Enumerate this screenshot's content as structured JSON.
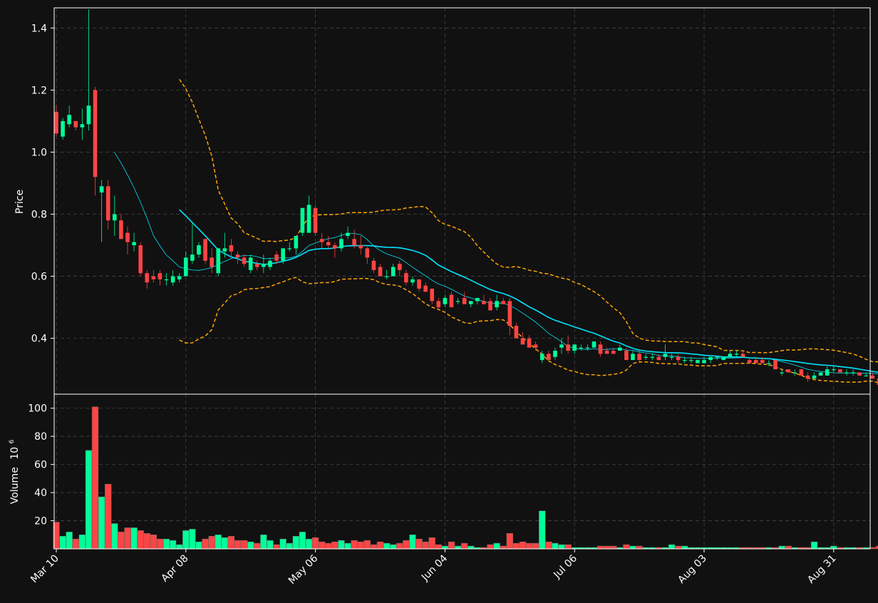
{
  "chart_data": [
    {
      "type": "candlestick",
      "ylabel": "Price",
      "ylim": [
        0.22,
        1.465
      ],
      "yticks": [
        0.4,
        0.6,
        0.8,
        1.0,
        1.2,
        1.4
      ],
      "grid": true,
      "x": {
        "start_date": "Mar 10",
        "tick_labels": [
          "Mar 10",
          "Apr 08",
          "May 06",
          "Jun 04",
          "Jul 06",
          "Aug 03",
          "Aug 31"
        ],
        "tick_index": [
          0,
          20,
          40,
          60,
          80,
          100,
          120
        ]
      },
      "ohlc": [
        [
          1.13,
          1.15,
          1.05,
          1.06
        ],
        [
          1.05,
          1.11,
          1.04,
          1.1
        ],
        [
          1.09,
          1.15,
          1.08,
          1.12
        ],
        [
          1.1,
          1.1,
          1.07,
          1.08
        ],
        [
          1.08,
          1.14,
          1.04,
          1.09
        ],
        [
          1.09,
          1.46,
          1.07,
          1.15
        ],
        [
          1.2,
          1.21,
          0.86,
          0.92
        ],
        [
          0.87,
          0.91,
          0.71,
          0.89
        ],
        [
          0.89,
          0.91,
          0.75,
          0.78
        ],
        [
          0.78,
          0.86,
          0.73,
          0.8
        ],
        [
          0.78,
          0.8,
          0.72,
          0.72
        ],
        [
          0.74,
          0.76,
          0.67,
          0.71
        ],
        [
          0.7,
          0.74,
          0.68,
          0.71
        ],
        [
          0.7,
          0.71,
          0.6,
          0.61
        ],
        [
          0.61,
          0.62,
          0.56,
          0.58
        ],
        [
          0.6,
          0.62,
          0.58,
          0.59
        ],
        [
          0.61,
          0.62,
          0.57,
          0.59
        ],
        [
          0.59,
          0.61,
          0.57,
          0.59
        ],
        [
          0.58,
          0.62,
          0.57,
          0.6
        ],
        [
          0.59,
          0.61,
          0.58,
          0.6
        ],
        [
          0.6,
          0.68,
          0.6,
          0.66
        ],
        [
          0.65,
          0.77,
          0.64,
          0.67
        ],
        [
          0.67,
          0.71,
          0.66,
          0.7
        ],
        [
          0.72,
          0.72,
          0.64,
          0.65
        ],
        [
          0.66,
          0.69,
          0.61,
          0.63
        ],
        [
          0.61,
          0.69,
          0.6,
          0.69
        ],
        [
          0.68,
          0.74,
          0.66,
          0.69
        ],
        [
          0.7,
          0.72,
          0.66,
          0.68
        ],
        [
          0.67,
          0.68,
          0.64,
          0.66
        ],
        [
          0.66,
          0.67,
          0.63,
          0.64
        ],
        [
          0.62,
          0.67,
          0.61,
          0.66
        ],
        [
          0.64,
          0.65,
          0.62,
          0.63
        ],
        [
          0.63,
          0.67,
          0.61,
          0.64
        ],
        [
          0.63,
          0.66,
          0.62,
          0.65
        ],
        [
          0.67,
          0.68,
          0.64,
          0.65
        ],
        [
          0.65,
          0.69,
          0.64,
          0.69
        ],
        [
          0.69,
          0.71,
          0.68,
          0.69
        ],
        [
          0.69,
          0.73,
          0.67,
          0.73
        ],
        [
          0.74,
          0.82,
          0.73,
          0.82
        ],
        [
          0.74,
          0.86,
          0.74,
          0.83
        ],
        [
          0.82,
          0.83,
          0.73,
          0.74
        ],
        [
          0.72,
          0.74,
          0.69,
          0.71
        ],
        [
          0.71,
          0.73,
          0.69,
          0.7
        ],
        [
          0.7,
          0.71,
          0.66,
          0.69
        ],
        [
          0.69,
          0.74,
          0.68,
          0.72
        ],
        [
          0.73,
          0.76,
          0.72,
          0.74
        ],
        [
          0.72,
          0.75,
          0.69,
          0.7
        ],
        [
          0.7,
          0.73,
          0.67,
          0.69
        ],
        [
          0.69,
          0.7,
          0.64,
          0.66
        ],
        [
          0.65,
          0.66,
          0.61,
          0.62
        ],
        [
          0.63,
          0.64,
          0.6,
          0.6
        ],
        [
          0.6,
          0.62,
          0.59,
          0.6
        ],
        [
          0.6,
          0.64,
          0.6,
          0.63
        ],
        [
          0.64,
          0.65,
          0.6,
          0.62
        ],
        [
          0.61,
          0.62,
          0.57,
          0.58
        ],
        [
          0.58,
          0.6,
          0.57,
          0.59
        ],
        [
          0.59,
          0.59,
          0.55,
          0.56
        ],
        [
          0.57,
          0.58,
          0.55,
          0.55
        ],
        [
          0.56,
          0.56,
          0.51,
          0.52
        ],
        [
          0.52,
          0.53,
          0.49,
          0.5
        ],
        [
          0.51,
          0.54,
          0.5,
          0.53
        ],
        [
          0.54,
          0.55,
          0.5,
          0.5
        ],
        [
          0.52,
          0.53,
          0.51,
          0.52
        ],
        [
          0.53,
          0.55,
          0.51,
          0.51
        ],
        [
          0.51,
          0.52,
          0.5,
          0.52
        ],
        [
          0.52,
          0.53,
          0.51,
          0.53
        ],
        [
          0.52,
          0.54,
          0.51,
          0.51
        ],
        [
          0.52,
          0.53,
          0.49,
          0.49
        ],
        [
          0.5,
          0.54,
          0.49,
          0.52
        ],
        [
          0.52,
          0.53,
          0.51,
          0.51
        ],
        [
          0.52,
          0.53,
          0.41,
          0.44
        ],
        [
          0.44,
          0.45,
          0.4,
          0.4
        ],
        [
          0.4,
          0.42,
          0.38,
          0.38
        ],
        [
          0.4,
          0.41,
          0.37,
          0.37
        ],
        [
          0.38,
          0.39,
          0.36,
          0.37
        ],
        [
          0.33,
          0.36,
          0.32,
          0.35
        ],
        [
          0.35,
          0.36,
          0.33,
          0.33
        ],
        [
          0.34,
          0.37,
          0.33,
          0.36
        ],
        [
          0.37,
          0.4,
          0.35,
          0.38
        ],
        [
          0.38,
          0.41,
          0.35,
          0.36
        ],
        [
          0.36,
          0.38,
          0.35,
          0.38
        ],
        [
          0.37,
          0.38,
          0.36,
          0.37
        ],
        [
          0.37,
          0.38,
          0.36,
          0.37
        ],
        [
          0.37,
          0.39,
          0.37,
          0.39
        ],
        [
          0.38,
          0.39,
          0.34,
          0.35
        ],
        [
          0.36,
          0.37,
          0.35,
          0.35
        ],
        [
          0.36,
          0.37,
          0.35,
          0.35
        ],
        [
          0.36,
          0.38,
          0.36,
          0.37
        ],
        [
          0.36,
          0.37,
          0.33,
          0.33
        ],
        [
          0.33,
          0.36,
          0.33,
          0.35
        ],
        [
          0.35,
          0.36,
          0.32,
          0.33
        ],
        [
          0.34,
          0.35,
          0.33,
          0.34
        ],
        [
          0.34,
          0.35,
          0.33,
          0.34
        ],
        [
          0.34,
          0.35,
          0.33,
          0.33
        ],
        [
          0.34,
          0.38,
          0.33,
          0.35
        ],
        [
          0.34,
          0.35,
          0.33,
          0.34
        ],
        [
          0.34,
          0.35,
          0.32,
          0.33
        ],
        [
          0.33,
          0.34,
          0.32,
          0.33
        ],
        [
          0.33,
          0.34,
          0.32,
          0.33
        ],
        [
          0.32,
          0.33,
          0.32,
          0.33
        ],
        [
          0.32,
          0.34,
          0.32,
          0.33
        ],
        [
          0.33,
          0.34,
          0.32,
          0.34
        ],
        [
          0.34,
          0.34,
          0.33,
          0.34
        ],
        [
          0.33,
          0.34,
          0.33,
          0.34
        ],
        [
          0.34,
          0.36,
          0.34,
          0.35
        ],
        [
          0.35,
          0.36,
          0.34,
          0.35
        ],
        [
          0.35,
          0.36,
          0.34,
          0.34
        ],
        [
          0.33,
          0.34,
          0.32,
          0.32
        ],
        [
          0.33,
          0.34,
          0.32,
          0.32
        ],
        [
          0.33,
          0.34,
          0.32,
          0.32
        ],
        [
          0.32,
          0.33,
          0.31,
          0.32
        ],
        [
          0.33,
          0.33,
          0.3,
          0.3
        ],
        [
          0.29,
          0.3,
          0.28,
          0.29
        ],
        [
          0.3,
          0.3,
          0.29,
          0.29
        ],
        [
          0.29,
          0.3,
          0.28,
          0.29
        ],
        [
          0.3,
          0.3,
          0.28,
          0.28
        ],
        [
          0.28,
          0.29,
          0.26,
          0.27
        ],
        [
          0.27,
          0.29,
          0.27,
          0.28
        ],
        [
          0.28,
          0.29,
          0.28,
          0.29
        ],
        [
          0.28,
          0.31,
          0.28,
          0.3
        ],
        [
          0.3,
          0.31,
          0.29,
          0.3
        ],
        [
          0.3,
          0.3,
          0.29,
          0.29
        ],
        [
          0.29,
          0.3,
          0.28,
          0.29
        ],
        [
          0.29,
          0.3,
          0.28,
          0.29
        ],
        [
          0.29,
          0.29,
          0.28,
          0.28
        ],
        [
          0.28,
          0.29,
          0.28,
          0.28
        ],
        [
          0.28,
          0.29,
          0.27,
          0.27
        ],
        [
          0.27,
          0.28,
          0.24,
          0.25
        ],
        [
          0.25,
          0.28,
          0.24,
          0.27
        ]
      ],
      "overlays": [
        {
          "kind": "moving-average-fast",
          "window": 10,
          "start_index": 9,
          "color": "#00e5ff",
          "width": 0.8,
          "dash": ""
        },
        {
          "kind": "moving-average-slow",
          "window": 20,
          "start_index": 19,
          "color": "#00e5ff",
          "width": 1.6,
          "dash": ""
        },
        {
          "kind": "band-upper",
          "window": 20,
          "start_index": 19,
          "color": "#ffa500",
          "width": 1.5,
          "dash": "5,3"
        },
        {
          "kind": "band-lower",
          "window": 20,
          "start_index": 19,
          "color": "#ffa500",
          "width": 1.5,
          "dash": "5,3"
        }
      ]
    },
    {
      "type": "bar",
      "ylabel": "Volume",
      "ylabel_exponent": "10",
      "ylabel_exponent_power": "6",
      "ylim": [
        0,
        110
      ],
      "yticks": [
        20,
        40,
        60,
        80,
        100
      ],
      "grid": true,
      "x": {
        "tick_labels": [
          "Mar 10",
          "Apr 08",
          "May 06",
          "Jun 04",
          "Jul 06",
          "Aug 03",
          "Aug 31"
        ],
        "tick_index": [
          0,
          20,
          40,
          60,
          80,
          100,
          120
        ]
      },
      "values": [
        19,
        9,
        12,
        7,
        10,
        70,
        101,
        37,
        46,
        18,
        12,
        15,
        15,
        13,
        11,
        10,
        7,
        7,
        6,
        3,
        13,
        14,
        5,
        7,
        9,
        10,
        8,
        9,
        6,
        6,
        5,
        4,
        10,
        6,
        3,
        7,
        4,
        9,
        12,
        7,
        8,
        5,
        4,
        5,
        6,
        4,
        6,
        5,
        6,
        3,
        5,
        4,
        3,
        4,
        6,
        10,
        7,
        5,
        8,
        3,
        2,
        5,
        2,
        4,
        2,
        1,
        1,
        3,
        4,
        2,
        11,
        4,
        5,
        4,
        4,
        27,
        5,
        4,
        3,
        3,
        1,
        1,
        1,
        1,
        2,
        2,
        2,
        1,
        3,
        2,
        2,
        1,
        1,
        1,
        1,
        3,
        2,
        2,
        1,
        1,
        1,
        1,
        1,
        1,
        1,
        1,
        1,
        1,
        1,
        1,
        1,
        1,
        2,
        2,
        1,
        1,
        1,
        5,
        1,
        1,
        2,
        1,
        1,
        1,
        1,
        1,
        1,
        2,
        5
      ]
    }
  ],
  "colors": {
    "background": "#111111",
    "up": "#00ff99",
    "down": "#ff4444",
    "grid": "#444444",
    "axis": "#ffffff"
  }
}
